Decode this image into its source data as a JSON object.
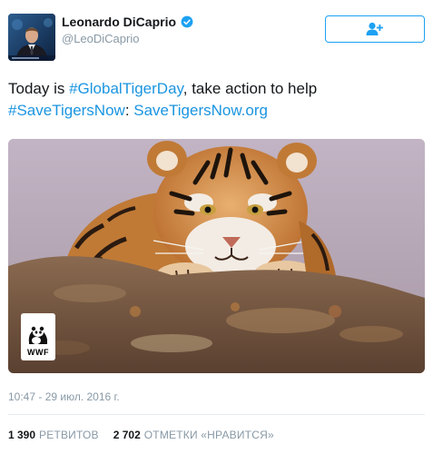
{
  "user": {
    "display_name": "Leonardo DiCaprio",
    "handle": "@LeoDiCaprio",
    "verified": true
  },
  "follow_button": {
    "icon": "add-user-icon"
  },
  "tweet": {
    "text_prefix": "Today is ",
    "hashtag1": "#GlobalTigerDay",
    "text_middle": ", take action to help",
    "hashtag2": "#SaveTigersNow",
    "separator": ": ",
    "url": "SaveTigersNow.org"
  },
  "media": {
    "logo_text": "WWF"
  },
  "timestamp": "10:47 - 29 июл. 2016 г.",
  "stats": {
    "retweets_count": "1 390",
    "retweets_label": "РЕТВИТОВ",
    "likes_count": "2 702",
    "likes_label": "ОТМЕТКИ «НРАВИТСЯ»"
  },
  "colors": {
    "link": "#1b95e0",
    "accent": "#1da1f2",
    "muted": "#8899a6"
  }
}
